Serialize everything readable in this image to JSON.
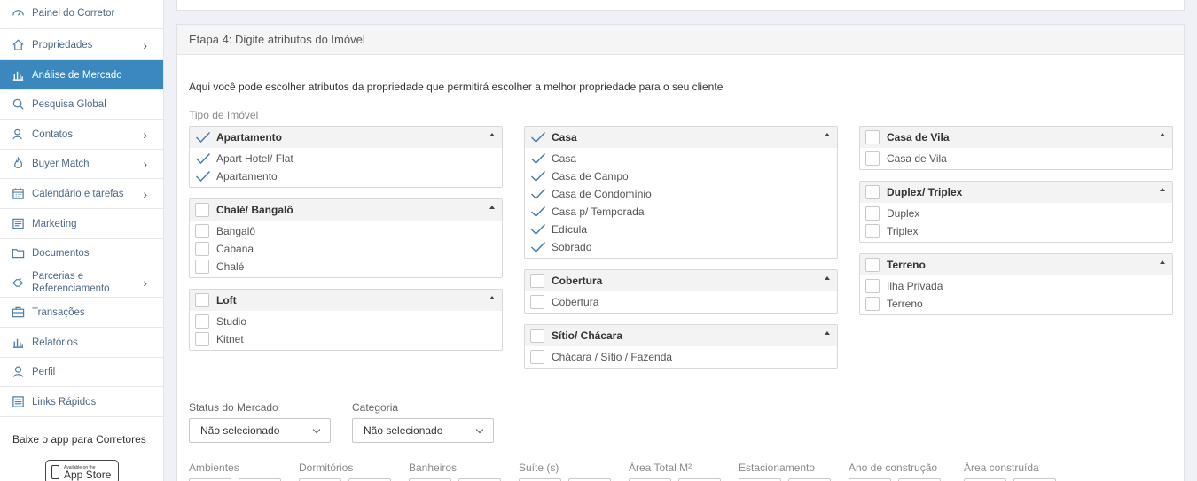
{
  "sidebar": {
    "items": [
      {
        "label": "Painel do Corretor",
        "icon": "dashboard-icon",
        "chevron": false,
        "active": false
      },
      {
        "label": "Propriedades",
        "icon": "home-icon",
        "chevron": true,
        "active": false
      },
      {
        "label": "Análise de Mercado",
        "icon": "bar-chart-icon",
        "chevron": false,
        "active": true
      },
      {
        "label": "Pesquisa Global",
        "icon": "search-icon",
        "chevron": false,
        "active": false
      },
      {
        "label": "Contatos",
        "icon": "contacts-icon",
        "chevron": true,
        "active": false
      },
      {
        "label": "Buyer Match",
        "icon": "fire-icon",
        "chevron": true,
        "active": false
      },
      {
        "label": "Calendário e tarefas",
        "icon": "calendar-icon",
        "chevron": true,
        "active": false
      },
      {
        "label": "Marketing",
        "icon": "megaphone-icon",
        "chevron": false,
        "active": false
      },
      {
        "label": "Documentos",
        "icon": "folder-icon",
        "chevron": false,
        "active": false
      },
      {
        "label": "Parcerias e Referenciamento",
        "icon": "handshake-icon",
        "chevron": true,
        "active": false
      },
      {
        "label": "Transações",
        "icon": "briefcase-icon",
        "chevron": false,
        "active": false
      },
      {
        "label": "Relatórios",
        "icon": "reports-icon",
        "chevron": false,
        "active": false
      },
      {
        "label": "Perfil",
        "icon": "user-icon",
        "chevron": false,
        "active": false
      },
      {
        "label": "Links Rápidos",
        "icon": "links-icon",
        "chevron": false,
        "active": false
      }
    ],
    "app_title": "Baixe o app para Corretores",
    "appstore_small": "Available on the",
    "appstore_big": "App Store"
  },
  "step": {
    "title": "Etapa 4: Digite atributos do Imóvel",
    "intro": "Aqui você pode escolher atributos da propriedade que permitirá escolher a melhor propriedade para o seu cliente",
    "tipo_label": "Tipo de Imóvel"
  },
  "categories": {
    "apartamento": {
      "title": "Apartamento",
      "checked": true,
      "options": [
        {
          "label": "Apart Hotel/ Flat",
          "checked": true
        },
        {
          "label": "Apartamento",
          "checked": true
        }
      ]
    },
    "chale": {
      "title": "Chalé/ Bangalô",
      "checked": false,
      "options": [
        {
          "label": "Bangalô",
          "checked": false
        },
        {
          "label": "Cabana",
          "checked": false
        },
        {
          "label": "Chalé",
          "checked": false
        }
      ]
    },
    "loft": {
      "title": "Loft",
      "checked": false,
      "options": [
        {
          "label": "Studio",
          "checked": false
        },
        {
          "label": "Kitnet",
          "checked": false
        }
      ]
    },
    "casa": {
      "title": "Casa",
      "checked": true,
      "options": [
        {
          "label": "Casa",
          "checked": true
        },
        {
          "label": "Casa de Campo",
          "checked": true
        },
        {
          "label": "Casa de Condomínio",
          "checked": true
        },
        {
          "label": "Casa p/ Temporada",
          "checked": true
        },
        {
          "label": "Edícula",
          "checked": true
        },
        {
          "label": "Sobrado",
          "checked": true
        }
      ]
    },
    "cobertura": {
      "title": "Cobertura",
      "checked": false,
      "options": [
        {
          "label": "Cobertura",
          "checked": false
        }
      ]
    },
    "sitio": {
      "title": "Sítio/ Chácara",
      "checked": false,
      "options": [
        {
          "label": "Chácara / Sítio / Fazenda",
          "checked": false
        }
      ]
    },
    "casavila": {
      "title": "Casa de Vila",
      "checked": false,
      "options": [
        {
          "label": "Casa de Vila",
          "checked": false
        }
      ]
    },
    "duplex": {
      "title": "Duplex/ Triplex",
      "checked": false,
      "options": [
        {
          "label": "Duplex",
          "checked": false
        },
        {
          "label": "Triplex",
          "checked": false
        }
      ]
    },
    "terreno": {
      "title": "Terreno",
      "checked": false,
      "options": [
        {
          "label": "Ilha Privada",
          "checked": false
        },
        {
          "label": "Terreno",
          "checked": false
        }
      ]
    }
  },
  "filters": {
    "status_label": "Status do Mercado",
    "status_value": "Não selecionado",
    "categoria_label": "Categoria",
    "categoria_value": "Não selecionado"
  },
  "ranges": {
    "labels": [
      "Ambientes",
      "Dormitórios",
      "Banheiros",
      "Suíte (s)",
      "Área Total M²",
      "Estacionamento",
      "Ano de construção",
      "Área construída"
    ]
  }
}
